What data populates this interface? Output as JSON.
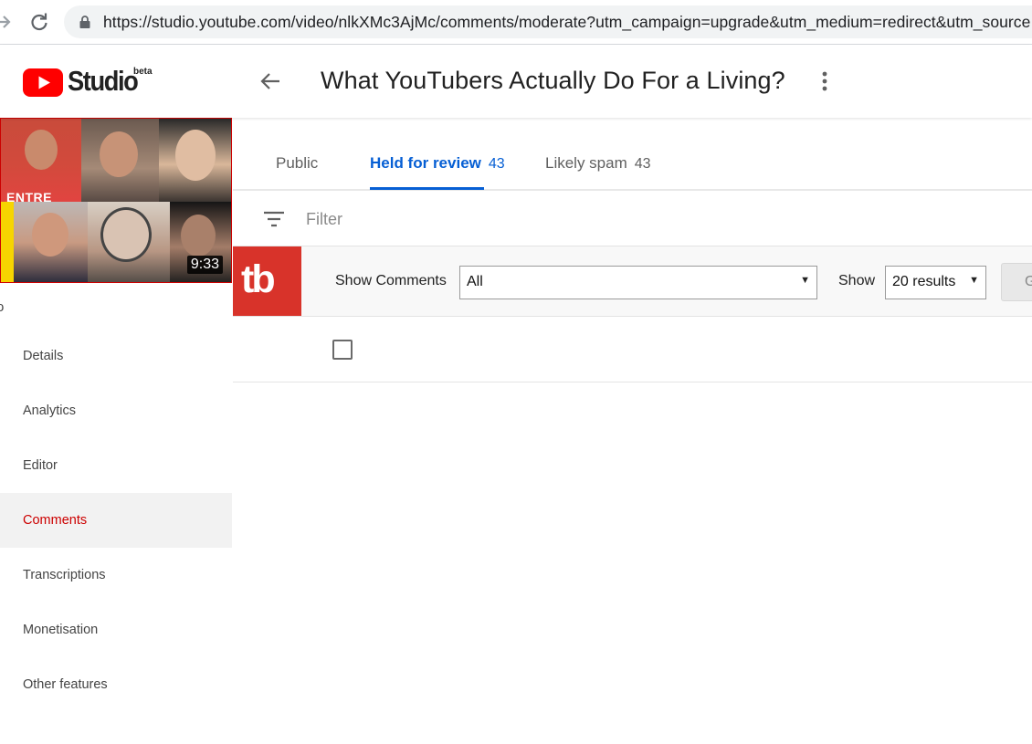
{
  "browser": {
    "url": "https://studio.youtube.com/video/nlkXMc3AjMc/comments/moderate?utm_campaign=upgrade&utm_medium=redirect&utm_source"
  },
  "header": {
    "brand": "Studio",
    "beta_label": "beta",
    "title": "What YouTubers Actually Do For a Living?"
  },
  "thumbnail": {
    "shirt_text": "ENTRE",
    "duration": "9:33"
  },
  "sidebar": {
    "cut_text": "o",
    "items": [
      {
        "label": "Details"
      },
      {
        "label": "Analytics"
      },
      {
        "label": "Editor"
      },
      {
        "label": "Comments"
      },
      {
        "label": "Transcriptions"
      },
      {
        "label": "Monetisation"
      },
      {
        "label": "Other features"
      }
    ],
    "active_index": 3
  },
  "tabs": [
    {
      "label": "Public",
      "count": ""
    },
    {
      "label": "Held for review",
      "count": "43"
    },
    {
      "label": "Likely spam",
      "count": "43"
    }
  ],
  "filter": {
    "placeholder": "Filter"
  },
  "tubebuddy": {
    "logo_text": "tb",
    "show_comments_label": "Show Comments",
    "show_comments_value": "All",
    "show_label": "Show",
    "results_value": "20 results",
    "go_label": "G"
  },
  "colors": {
    "accent_blue": "#065fd4",
    "youtube_red": "#ff0000",
    "active_nav_red": "#cc0000",
    "tubebuddy_red": "#d8332a"
  },
  "icons": {
    "forward": "arrow-right-icon",
    "reload": "reload-icon",
    "lock": "lock-icon",
    "back": "arrow-left-icon",
    "more": "more-vert-icon",
    "filter": "filter-icon",
    "dropdown": "dropdown-arrow-icon"
  }
}
